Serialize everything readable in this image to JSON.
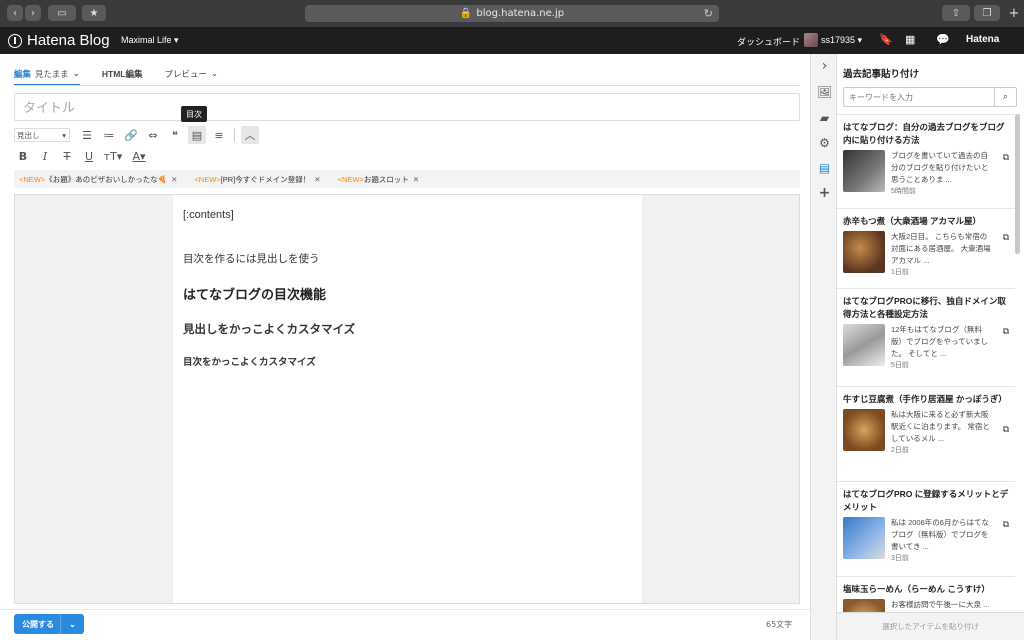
{
  "browser": {
    "url": "blog.hatena.ne.jp"
  },
  "header": {
    "logo": "Hatena Blog",
    "blog_name": "Maximal Life ▾",
    "dashboard": "ダッシュボード",
    "user": "ss17935 ▾",
    "brand": "Hatena"
  },
  "editor": {
    "tabs": [
      {
        "label": "編集",
        "sub": "見たまま"
      },
      {
        "label": "HTML編集"
      },
      {
        "label": "プレビュー"
      }
    ],
    "title_placeholder": "タイトル",
    "tooltip": "目次",
    "heading_select": "見出し",
    "keywords": [
      {
        "new": "<NEW>",
        "text": "《お題》あのピザおいしかったな🍕"
      },
      {
        "new": "<NEW>",
        "text": "[PR]今すぐドメイン登録！"
      },
      {
        "new": "<NEW>",
        "text": "お題スロット"
      }
    ],
    "content": {
      "line1": "[:contents]",
      "line2": "目次を作るには見出しを使う",
      "line3": "はてなブログの目次機能",
      "line4": "見出しをかっこよくカスタマイズ",
      "line5": "目次をかっこよくカスタマイズ"
    },
    "publish": "公開する",
    "char_count": "65文字"
  },
  "panel": {
    "title": "過去記事貼り付け",
    "search_placeholder": "キーワードを入力",
    "items": [
      {
        "title": "はてなブログ：自分の過去ブログをブログ内に貼り付ける方法",
        "excerpt": "ブログを書いていて過去の自分のブログを貼り付けたいと思うことありま ...",
        "time": "5時間前"
      },
      {
        "title": "赤辛もつ煮（大衆酒場 アカマル屋）",
        "excerpt": "大阪2日目。 こちらも常宿の対面にある居酒屋。 大衆酒場 アカマル ...",
        "time": "1日前"
      },
      {
        "title": "はてなブログPROに移行、独自ドメイン取得方法と各種設定方法",
        "excerpt": "12年もはてなブログ（無料版）でブログをやっていました。 そしてと ...",
        "time": "5日前"
      },
      {
        "title": "牛すじ豆腐煮（手作り居酒屋 かっぽうぎ）",
        "excerpt": "私は大阪に来ると必ず新大阪駅近くに泊まります。 常宿としているメル ...",
        "time": "2日前"
      },
      {
        "title": "はてなブログPRO に登録するメリットとデメリット",
        "excerpt": "私は 2006年の6月からはてなブログ（無料版）でブログを書いてき ...",
        "time": "3日前"
      },
      {
        "title": "塩味玉らーめん（らーめん こうすけ）",
        "excerpt": "お客様訪問で午後一に大泉 ...",
        "time": ""
      }
    ],
    "paste_button": "選択したアイテムを貼り付け"
  }
}
